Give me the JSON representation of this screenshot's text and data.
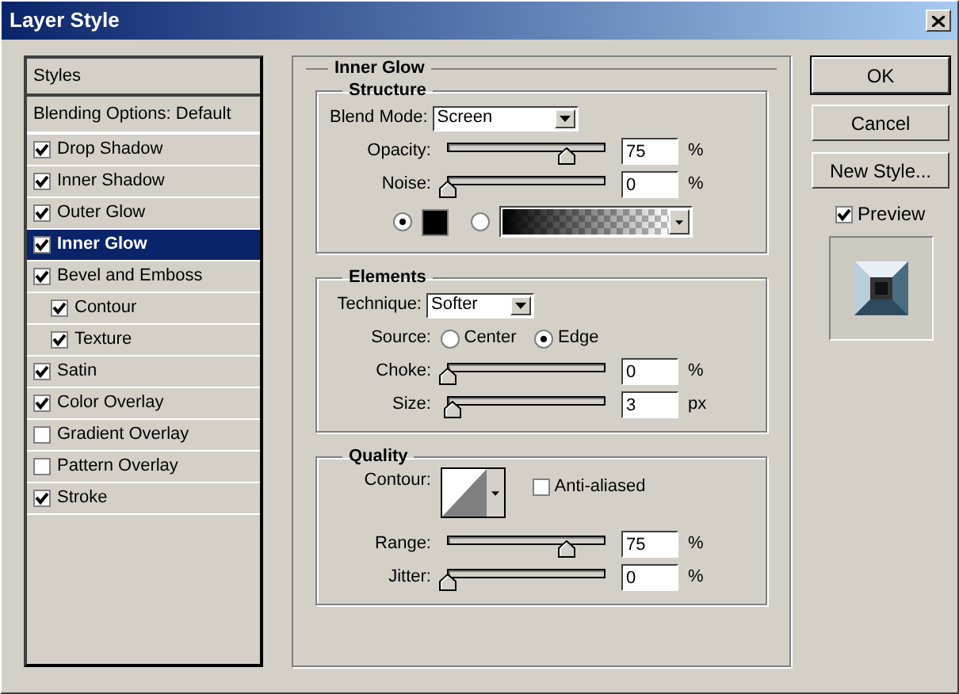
{
  "window": {
    "title": "Layer Style"
  },
  "sidebar": {
    "header": "Styles",
    "items": [
      {
        "label": "Blending Options: Default",
        "kind": "plain",
        "selected": false
      },
      {
        "label": "Drop Shadow",
        "kind": "check",
        "checked": true,
        "selected": false
      },
      {
        "label": "Inner Shadow",
        "kind": "check",
        "checked": true,
        "selected": false
      },
      {
        "label": "Outer Glow",
        "kind": "check",
        "checked": true,
        "selected": false
      },
      {
        "label": "Inner Glow",
        "kind": "check",
        "checked": true,
        "selected": true
      },
      {
        "label": "Bevel and Emboss",
        "kind": "check",
        "checked": true,
        "selected": false,
        "children": [
          {
            "label": "Contour",
            "kind": "check",
            "checked": true,
            "selected": false
          },
          {
            "label": "Texture",
            "kind": "check",
            "checked": true,
            "selected": false
          }
        ]
      },
      {
        "label": "Satin",
        "kind": "check",
        "checked": true,
        "selected": false
      },
      {
        "label": "Color Overlay",
        "kind": "check",
        "checked": true,
        "selected": false
      },
      {
        "label": "Gradient Overlay",
        "kind": "check",
        "checked": false,
        "selected": false
      },
      {
        "label": "Pattern Overlay",
        "kind": "check",
        "checked": false,
        "selected": false
      },
      {
        "label": "Stroke",
        "kind": "check",
        "checked": true,
        "selected": false
      }
    ]
  },
  "panel": {
    "title": "Inner Glow",
    "structure": {
      "title": "Structure",
      "blend_mode": {
        "label": "Blend Mode:",
        "value": "Screen"
      },
      "sliders": [
        {
          "label": "Opacity:",
          "level": 0.75,
          "value": "75",
          "unit": "%"
        },
        {
          "label": "Noise:",
          "level": 0,
          "value": "0",
          "unit": "%"
        }
      ],
      "fill": [
        {
          "kind": "color",
          "selected": true,
          "color": "#000000"
        },
        {
          "kind": "gradient",
          "selected": false
        }
      ]
    },
    "elements": {
      "title": "Elements",
      "technique": {
        "label": "Technique:",
        "value": "Softer"
      },
      "source": {
        "label": "Source:",
        "options": [
          {
            "label": "Center",
            "selected": false
          },
          {
            "label": "Edge",
            "selected": true
          }
        ]
      },
      "sliders": [
        {
          "label": "Choke:",
          "level": 0,
          "value": "0",
          "unit": "%"
        },
        {
          "label": "Size:",
          "level": 0.03,
          "value": "3",
          "unit": "px"
        }
      ]
    },
    "quality": {
      "title": "Quality",
      "contour": {
        "label": "Contour:"
      },
      "anti_aliased": {
        "label": "Anti-aliased",
        "checked": false
      },
      "sliders": [
        {
          "label": "Range:",
          "level": 0.75,
          "value": "75",
          "unit": "%"
        },
        {
          "label": "Jitter:",
          "level": 0,
          "value": "0",
          "unit": "%"
        }
      ]
    }
  },
  "buttons": [
    "OK",
    "Cancel",
    "New Style..."
  ],
  "preview": {
    "label": "Preview",
    "checked": true
  }
}
